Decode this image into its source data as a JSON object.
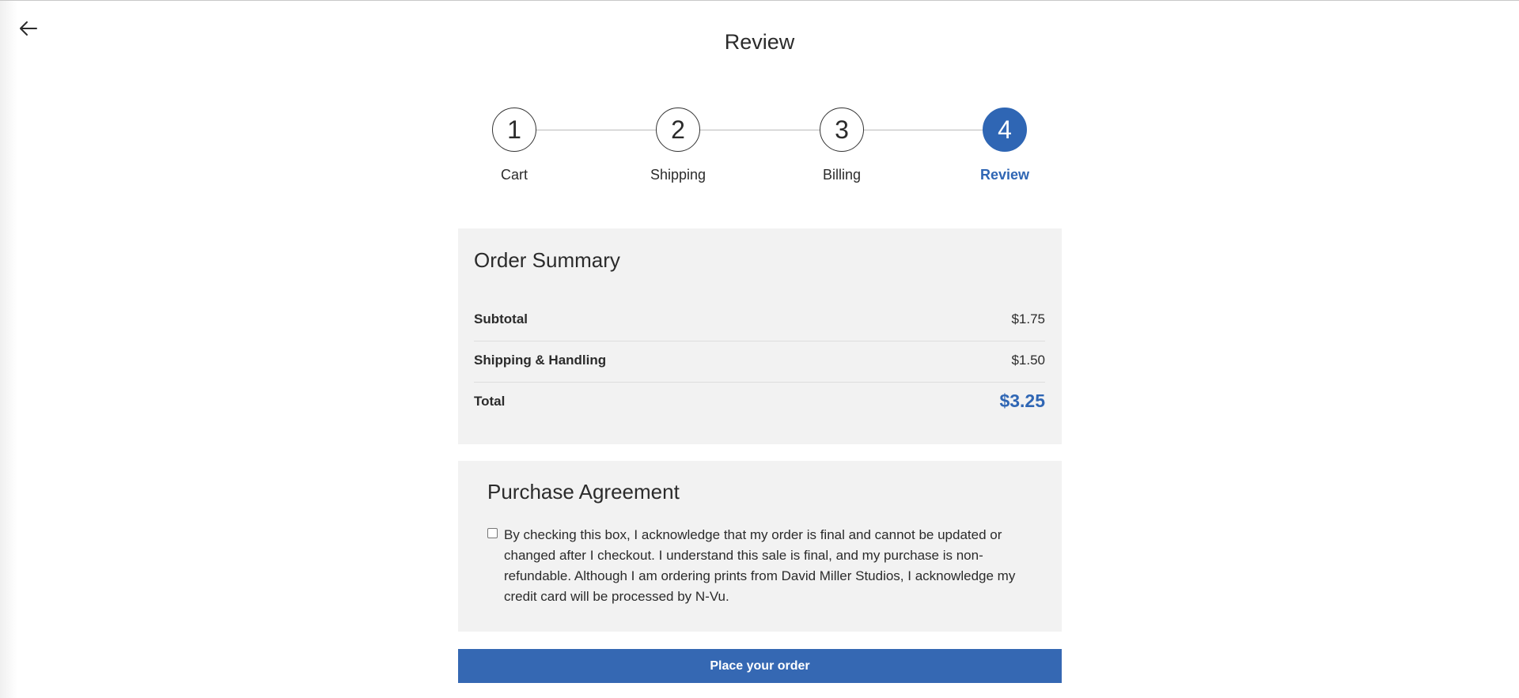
{
  "page": {
    "title": "Review",
    "back_icon": "arrow-left-icon"
  },
  "stepper": {
    "steps": [
      {
        "number": "1",
        "label": "Cart",
        "active": false
      },
      {
        "number": "2",
        "label": "Shipping",
        "active": false
      },
      {
        "number": "3",
        "label": "Billing",
        "active": false
      },
      {
        "number": "4",
        "label": "Review",
        "active": true
      }
    ]
  },
  "order_summary": {
    "title": "Order Summary",
    "rows": [
      {
        "label": "Subtotal",
        "value": "$1.75"
      },
      {
        "label": "Shipping & Handling",
        "value": "$1.50"
      },
      {
        "label": "Total",
        "value": "$3.25"
      }
    ]
  },
  "purchase_agreement": {
    "title": "Purchase Agreement",
    "checkbox_checked": false,
    "text": "By checking this box, I acknowledge that my order is final and cannot be updated or changed after I checkout. I understand this sale is final, and my purchase is non-refundable. Although I am ordering prints from David Miller Studios, I acknowledge my credit card will be processed by N-Vu."
  },
  "actions": {
    "place_order_label": "Place your order"
  },
  "colors": {
    "accent": "#2f66b4",
    "button": "#3568b3",
    "panel_bg": "#f2f2f2"
  }
}
